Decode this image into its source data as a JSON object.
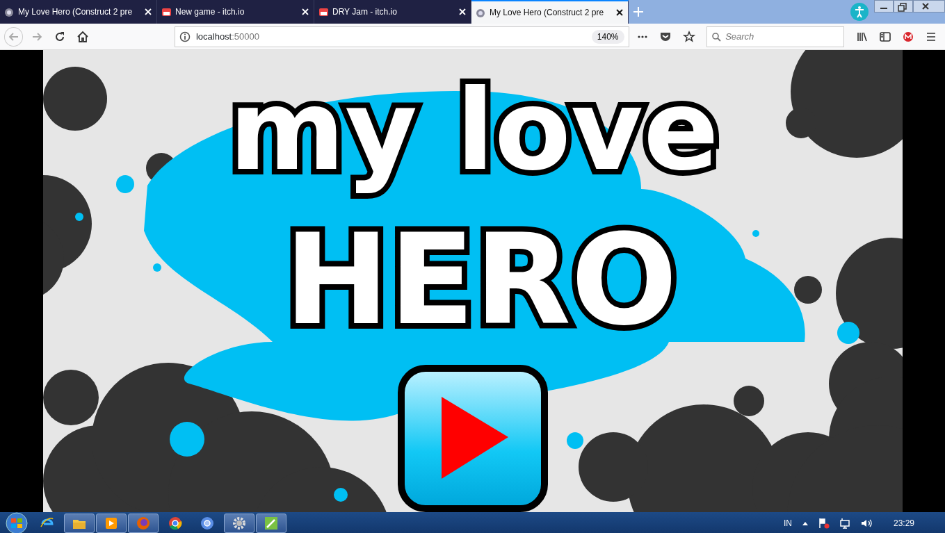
{
  "tabs": [
    {
      "title": "My Love Hero (Construct 2 pre",
      "selected": false
    },
    {
      "title": "New game - itch.io",
      "selected": false
    },
    {
      "title": "DRY Jam - itch.io",
      "selected": false
    },
    {
      "title": "My Love Hero (Construct 2 pre",
      "selected": true
    }
  ],
  "address": {
    "host": "localhost",
    "port": ":50000",
    "zoom": "140%"
  },
  "search": {
    "placeholder": "Search"
  },
  "game": {
    "title_line_1": "my love",
    "title_line_2": "HERO"
  },
  "taskbar": {
    "items": [
      {
        "running": false
      },
      {
        "running": true
      },
      {
        "running": true
      },
      {
        "running": true
      },
      {
        "running": false
      },
      {
        "running": false
      },
      {
        "running": true
      },
      {
        "running": true
      }
    ],
    "language": "IN",
    "time": "23:29"
  }
}
